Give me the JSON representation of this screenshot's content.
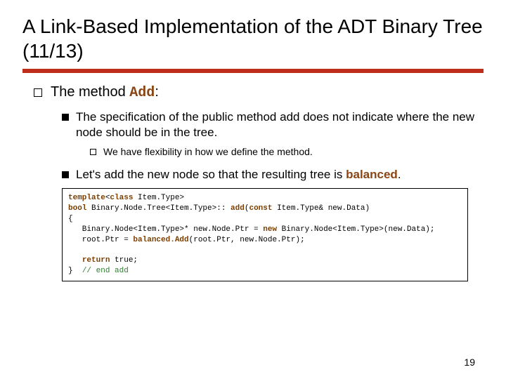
{
  "title": "A Link-Based Implementation of the ADT Binary Tree (11/13)",
  "bullets": {
    "b1_pre": "The method ",
    "b1_code": "Add",
    "b1_post": ":",
    "b2": "The specification of the public method add does not indicate where the new node should be in the tree.",
    "b3": "We have flexibility in how we define the method.",
    "b4_pre": "Let's add the new node so that the resulting tree is ",
    "b4_bold": "balanced",
    "b4_post": "."
  },
  "code": {
    "l1a": "template",
    "l1b": "<",
    "l1c": "class",
    "l1d": " Item.Type>",
    "l2a": "bool",
    "l2b": " Binary.Node.Tree<Item.Type>:: ",
    "l2c": "add",
    "l2d": "(",
    "l2e": "const",
    "l2f": " Item.Type& new.Data)",
    "l3": "{",
    "l4a": "   Binary.Node<Item.Type>* new.Node.Ptr = ",
    "l4b": "new",
    "l4c": " Binary.Node<Item.Type>(new.Data);",
    "l5a": "   root.Ptr = ",
    "l5b": "balanced.Add",
    "l5c": "(root.Ptr, new.Node.Ptr);",
    "blank": "",
    "l6a": "   ",
    "l6b": "return",
    "l6c": " true;",
    "l7a": "}  ",
    "l7b": "// end add"
  },
  "page_number": "19"
}
